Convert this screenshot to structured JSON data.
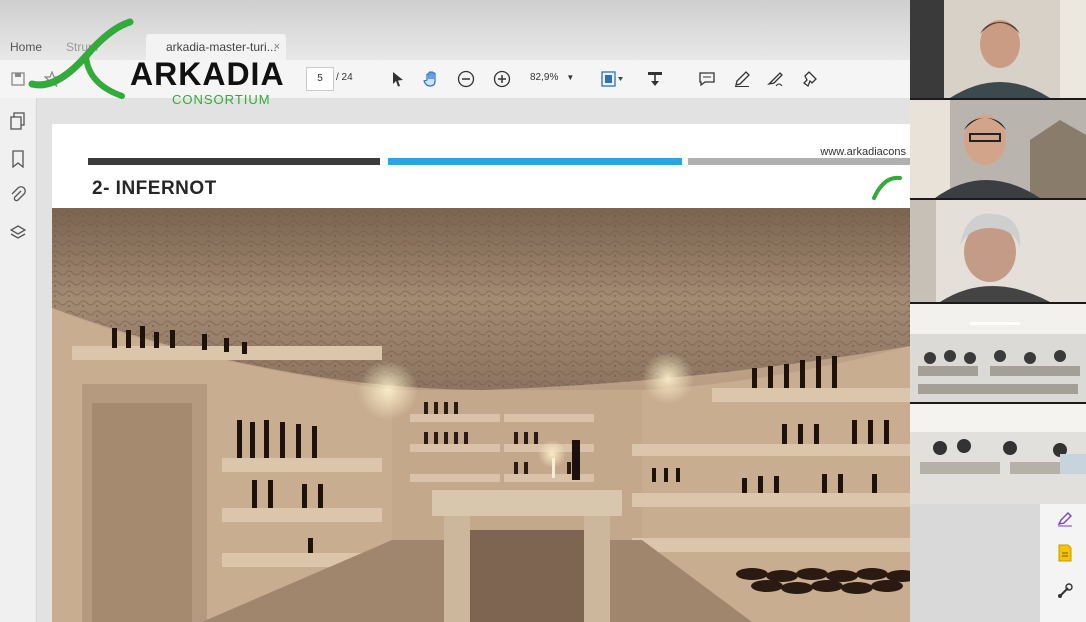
{
  "browser": {
    "tabs": [
      {
        "label": "Home"
      },
      {
        "label": "Strum"
      },
      {
        "label": "arkadia-master-turi...",
        "close": "×"
      }
    ]
  },
  "toolbar": {
    "page_current": "5",
    "page_total": "/ 24",
    "zoom": "82,9%"
  },
  "slide": {
    "url": "www.arkadiacons",
    "title": "2- INFERNOT"
  },
  "brand": {
    "name": "ARKADIA",
    "subtitle": "CONSORTIUM",
    "color_green": "#33aa3a"
  },
  "colors": {
    "accent_blue": "#2aa5de",
    "dark_bar": "#3b3b3b",
    "grey_bar": "#b0b0b0"
  },
  "icons": [
    "save-icon",
    "star-icon",
    "cursor-icon",
    "hand-icon",
    "zoom-out-icon",
    "zoom-in-icon",
    "fit-icon",
    "stamp-icon",
    "comment-icon",
    "pen-icon",
    "sign-icon",
    "share-icon",
    "pages-icon",
    "bookmark-icon",
    "attachment-icon",
    "layers-icon"
  ]
}
